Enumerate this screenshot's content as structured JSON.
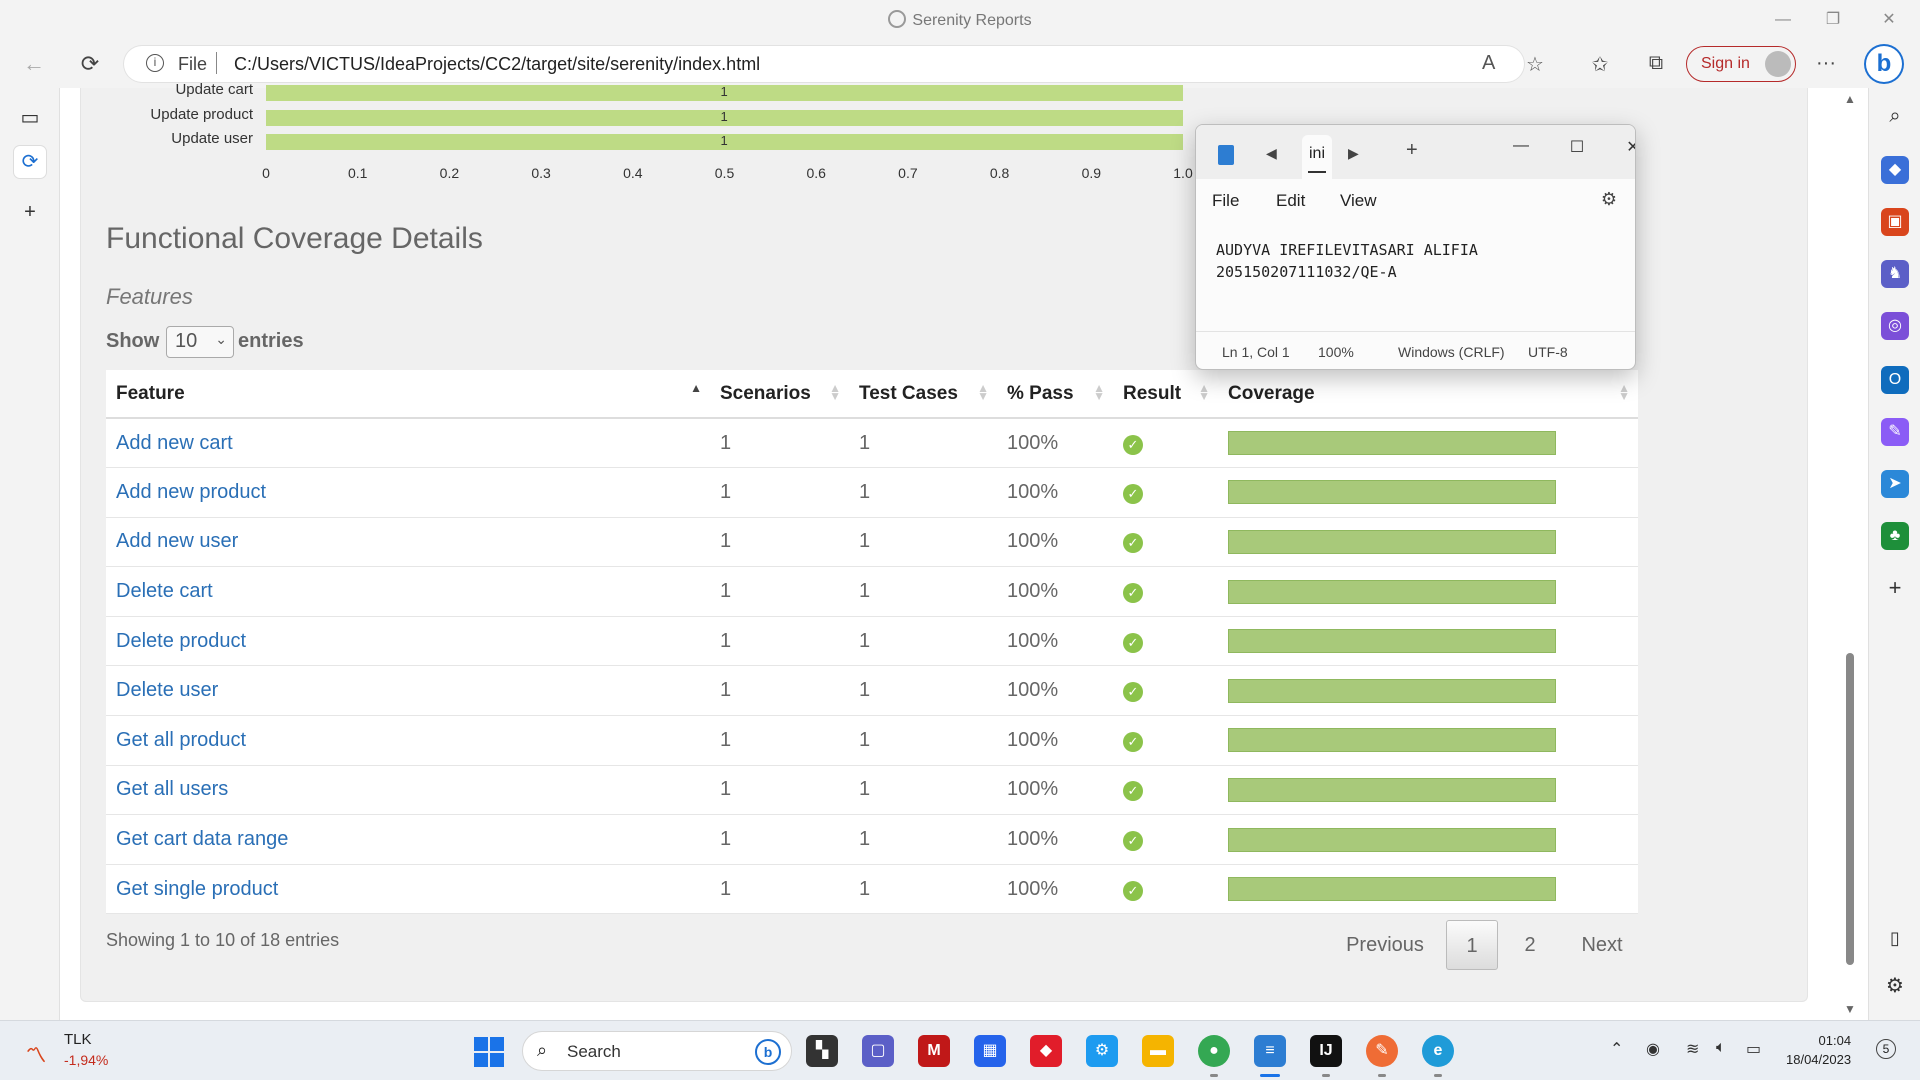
{
  "window": {
    "title": "Serenity Reports",
    "controls": {
      "minimize": "—",
      "restore": "❐",
      "close": "✕"
    }
  },
  "browser": {
    "back": "←",
    "reload": "⟳",
    "protocol_label": "File",
    "url": "C:/Users/VICTUS/IdeaProjects/CC2/target/site/serenity/index.html",
    "sign_in": "Sign in",
    "more": "···",
    "bing": "b"
  },
  "chart_data": {
    "type": "bar",
    "orientation": "horizontal",
    "categories": [
      "Update cart",
      "Update product",
      "Update user"
    ],
    "values": [
      1,
      1,
      1
    ],
    "xticks": [
      "0",
      "0.1",
      "0.2",
      "0.3",
      "0.4",
      "0.5",
      "0.6",
      "0.7",
      "0.8",
      "0.9",
      "1.0"
    ],
    "xlim": [
      0,
      1
    ],
    "color": "#bedb85"
  },
  "coverage": {
    "section_title": "Functional Coverage Details",
    "subtitle": "Features",
    "show_label": "Show",
    "page_size": "10",
    "entries_label": "entries",
    "columns": [
      "Feature",
      "Scenarios",
      "Test Cases",
      "% Pass",
      "Result",
      "Coverage"
    ],
    "rows": [
      {
        "feature": "Add new cart",
        "scenarios": "1",
        "test_cases": "1",
        "pass": "100%",
        "coverage": 1.0
      },
      {
        "feature": "Add new product",
        "scenarios": "1",
        "test_cases": "1",
        "pass": "100%",
        "coverage": 1.0
      },
      {
        "feature": "Add new user",
        "scenarios": "1",
        "test_cases": "1",
        "pass": "100%",
        "coverage": 1.0
      },
      {
        "feature": "Delete cart",
        "scenarios": "1",
        "test_cases": "1",
        "pass": "100%",
        "coverage": 1.0
      },
      {
        "feature": "Delete product",
        "scenarios": "1",
        "test_cases": "1",
        "pass": "100%",
        "coverage": 1.0
      },
      {
        "feature": "Delete user",
        "scenarios": "1",
        "test_cases": "1",
        "pass": "100%",
        "coverage": 1.0
      },
      {
        "feature": "Get all product",
        "scenarios": "1",
        "test_cases": "1",
        "pass": "100%",
        "coverage": 1.0
      },
      {
        "feature": "Get all users",
        "scenarios": "1",
        "test_cases": "1",
        "pass": "100%",
        "coverage": 1.0
      },
      {
        "feature": "Get cart data range",
        "scenarios": "1",
        "test_cases": "1",
        "pass": "100%",
        "coverage": 1.0
      },
      {
        "feature": "Get single product",
        "scenarios": "1",
        "test_cases": "1",
        "pass": "100%",
        "coverage": 1.0
      }
    ],
    "showing": "Showing 1 to 10 of 18 entries",
    "pager": {
      "previous": "Previous",
      "page1": "1",
      "page2": "2",
      "next": "Next"
    },
    "result_color": "#8bc34a",
    "coverage_color": "#a8c97a"
  },
  "notepad": {
    "tab": "ini",
    "menu": [
      "File",
      "Edit",
      "View"
    ],
    "text": "AUDYVA IREFILEVITASARI ALIFIA\n205150207111032/QE-A",
    "status": {
      "position": "Ln 1, Col 1",
      "zoom": "100%",
      "line_ending": "Windows (CRLF)",
      "encoding": "UTF-8"
    }
  },
  "taskbar": {
    "stock_name": "TLK",
    "stock_change": "-1,94%",
    "search_label": "Search",
    "time": "01:04",
    "date": "18/04/2023",
    "notifications": "5"
  }
}
